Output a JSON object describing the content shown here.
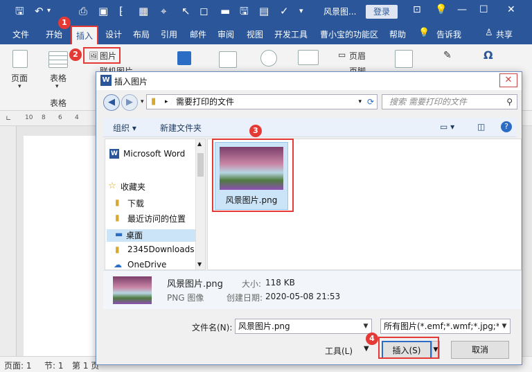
{
  "title_bar": {
    "doc_title": "风景图...",
    "login_label": "登录"
  },
  "tabs": [
    "文件",
    "开始",
    "插入",
    "设计",
    "布局",
    "引用",
    "邮件",
    "审阅",
    "视图",
    "开发工具",
    "曹小宝的功能区",
    "帮助",
    "告诉我",
    "共享"
  ],
  "ribbon": {
    "page_label": "页面",
    "table_label": "表格",
    "table_group_label": "表格",
    "picture_label": "图片",
    "online_picture_label": "联机图片",
    "header_label": "页眉",
    "footer_label": "页脚"
  },
  "ruler": {
    "ticks": [
      "10",
      "8",
      "6",
      "4"
    ]
  },
  "statusbar": {
    "page": "页面: 1",
    "section": "节: 1",
    "pos": "第 1 页"
  },
  "markers": [
    "1",
    "2",
    "3",
    "4"
  ],
  "dialog": {
    "title": "插入图片",
    "close": "✕",
    "address": "需要打印的文件",
    "search_placeholder": "搜索 需要打印的文件",
    "organize": "组织 ▾",
    "new_folder": "新建文件夹",
    "nav": [
      "Microsoft Word",
      "收藏夹",
      "下载",
      "最近访问的位置",
      "桌面",
      "2345Downloads",
      "OneDrive"
    ],
    "file_name": "风景图片.png",
    "details": {
      "name": "风景图片.png",
      "type": "PNG 图像",
      "size_label": "大小:",
      "size_value": "118 KB",
      "date_label": "创建日期:",
      "date_value": "2020-05-08 21:53"
    },
    "filename_label": "文件名(N):",
    "filename_value": "风景图片.png",
    "filter_value": "所有图片(*.emf;*.wmf;*.jpg;*.jp",
    "tools_label": "工具(L)",
    "insert_label": "插入(S)",
    "cancel_label": "取消"
  },
  "colors": {
    "accent": "#2b579a",
    "marker": "#e53935"
  }
}
